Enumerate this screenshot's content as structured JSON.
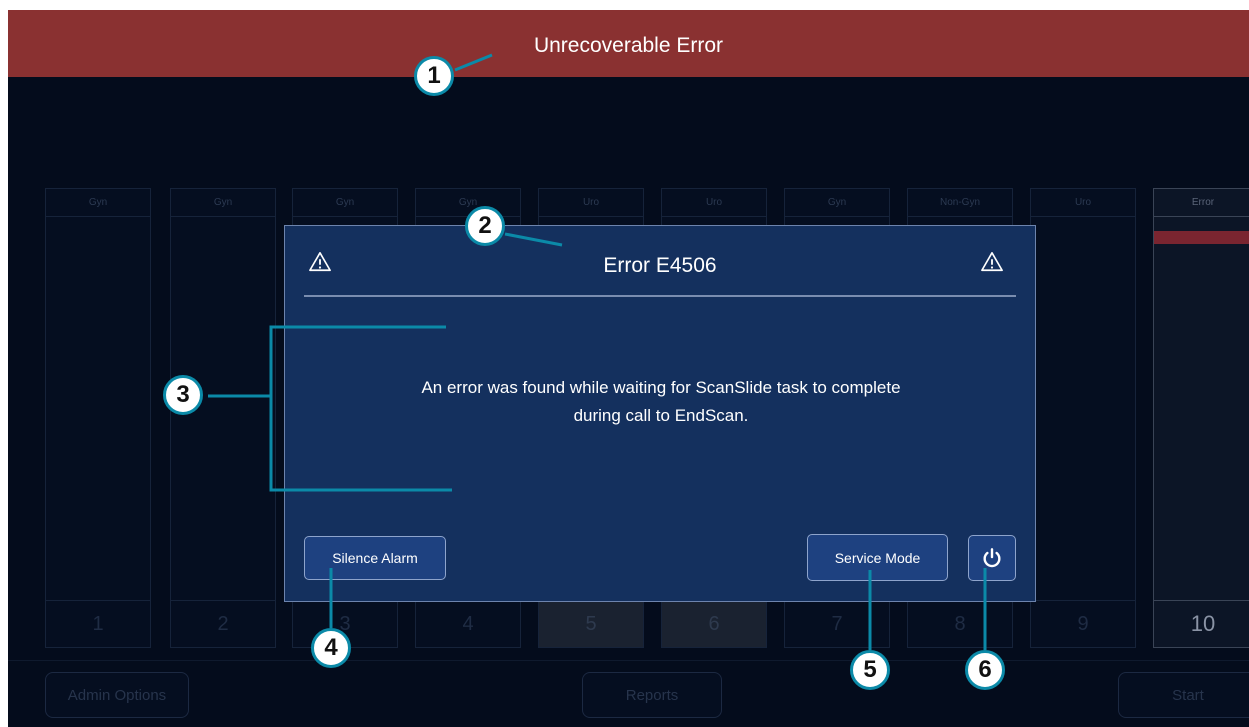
{
  "header": {
    "title": "Unrecoverable Error"
  },
  "slots": [
    {
      "type": "Gyn",
      "number": "1"
    },
    {
      "type": "Gyn",
      "number": "2"
    },
    {
      "type": "Gyn",
      "number": "3"
    },
    {
      "type": "Gyn",
      "number": "4"
    },
    {
      "type": "Uro",
      "number": "5"
    },
    {
      "type": "Uro",
      "number": "6"
    },
    {
      "type": "Gyn",
      "number": "7"
    },
    {
      "type": "Non-Gyn",
      "number": "8"
    },
    {
      "type": "Uro",
      "number": "9"
    },
    {
      "type": "Error",
      "number": "10"
    }
  ],
  "bottom_bar": {
    "admin_label": "Admin Options",
    "reports_label": "Reports",
    "start_label": "Start"
  },
  "dialog": {
    "title": "Error E4506",
    "message_line1": "An error was found while waiting for ScanSlide task to complete",
    "message_line2": "during call to EndScan.",
    "silence_label": "Silence Alarm",
    "service_label": "Service Mode",
    "left_icon": "warning-triangle",
    "right_icon": "warning-triangle",
    "power_icon": "power"
  },
  "callouts": [
    "1",
    "2",
    "3",
    "4",
    "5",
    "6"
  ],
  "colors": {
    "title_bar": "#8a3131",
    "dialog_bg": "#14305e",
    "callout_ring": "#0b8aa8"
  }
}
